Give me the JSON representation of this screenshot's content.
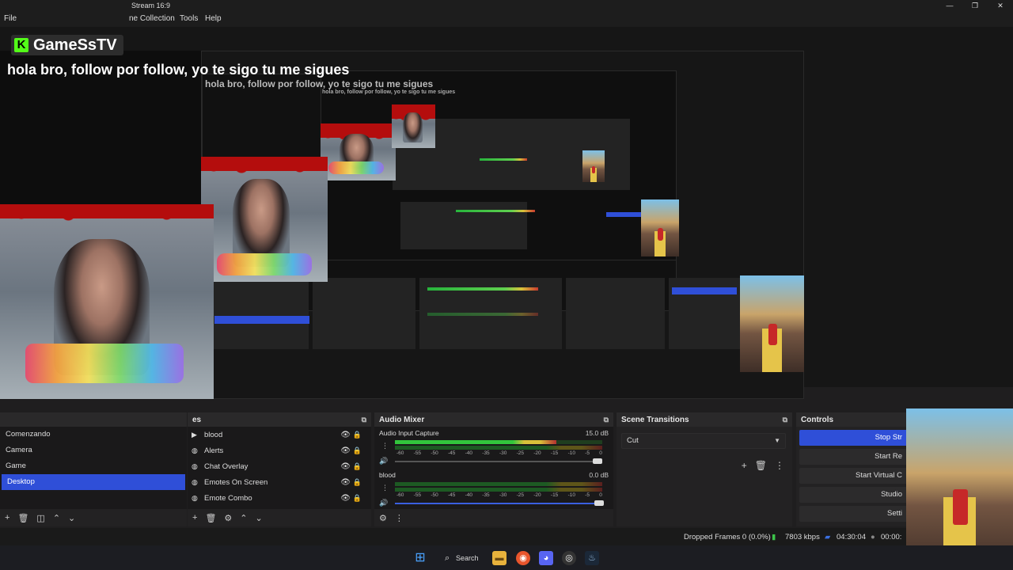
{
  "window": {
    "title": "Stream 16:9",
    "controls": [
      "—",
      "❐",
      "✕"
    ]
  },
  "menu": {
    "file": "File",
    "scene_collection": "ne Collection",
    "tools": "Tools",
    "help": "Help"
  },
  "overlay": {
    "brand": "GameSsTV",
    "chat_message": "hola bro, follow por follow, yo te sigo tu me sigues"
  },
  "scenes": {
    "items": [
      "Comenzando",
      "Camera",
      "Game",
      "Desktop"
    ],
    "selected": "Desktop"
  },
  "sources": {
    "header": "es",
    "items": [
      "blood",
      "Alerts",
      "Chat Overlay",
      "Emotes On Screen",
      "Emote Combo"
    ]
  },
  "mixer": {
    "title": "Audio Mixer",
    "channels": [
      {
        "name": "Audio Input Capture",
        "db": "15.0 dB",
        "level": 0.78
      },
      {
        "name": "blood",
        "db": "0.0 dB",
        "level": 0.0
      }
    ],
    "scale": [
      "-60",
      "-55",
      "-50",
      "-45",
      "-40",
      "-35",
      "-30",
      "-25",
      "-20",
      "-15",
      "-10",
      "-5",
      "0"
    ]
  },
  "transitions": {
    "title": "Scene Transitions",
    "selected": "Cut"
  },
  "controls": {
    "title": "Controls",
    "buttons": [
      "Stop Str",
      "Start Re",
      "Start Virtual C",
      "Studio",
      "Setti"
    ]
  },
  "status": {
    "dropped_frames": "Dropped Frames 0 (0.0%)",
    "bitrate": "7803 kbps",
    "live_time": "04:30:04",
    "rec_time": "00:00:"
  },
  "taskbar": {
    "search": "Search"
  },
  "colors": {
    "accent": "#2f4fd8",
    "kick_green": "#53fc18"
  }
}
